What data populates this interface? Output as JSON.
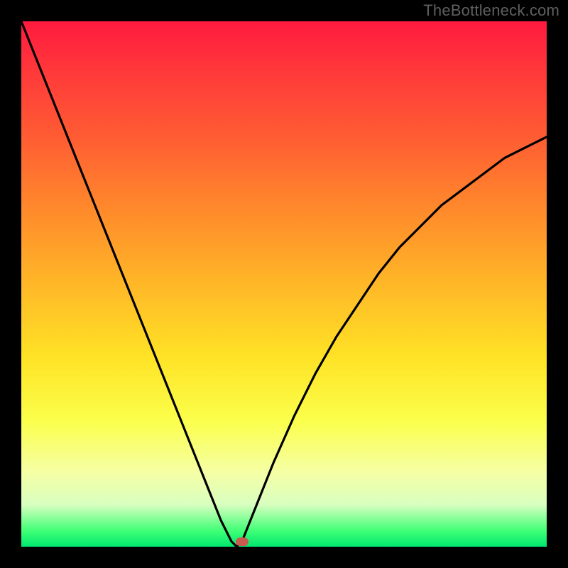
{
  "watermark": "TheBottleneck.com",
  "colors": {
    "frame_bg": "#000000",
    "gradient_top": "#ff1a3f",
    "gradient_bottom": "#00e86f",
    "curve": "#000000",
    "marker": "#c95a4f"
  },
  "chart_data": {
    "type": "line",
    "title": "",
    "xlabel": "",
    "ylabel": "",
    "xlim": [
      0,
      100
    ],
    "ylim": [
      0,
      100
    ],
    "series": [
      {
        "name": "curve",
        "x": [
          0,
          4,
          8,
          12,
          16,
          20,
          24,
          28,
          32,
          36,
          38,
          40,
          41,
          42,
          44,
          48,
          52,
          56,
          60,
          64,
          68,
          72,
          76,
          80,
          84,
          88,
          92,
          96,
          100
        ],
        "values": [
          100,
          90,
          80,
          70,
          60,
          50,
          40,
          30,
          20,
          10,
          5,
          1,
          0,
          1,
          6,
          16,
          25,
          33,
          40,
          46,
          52,
          57,
          61,
          65,
          68,
          71,
          74,
          76,
          78
        ]
      }
    ],
    "marker": {
      "x": 42,
      "y": 1
    },
    "gradient_meaning": "background color encodes qualitative zone, top=red (bad) to bottom=green (good)"
  }
}
